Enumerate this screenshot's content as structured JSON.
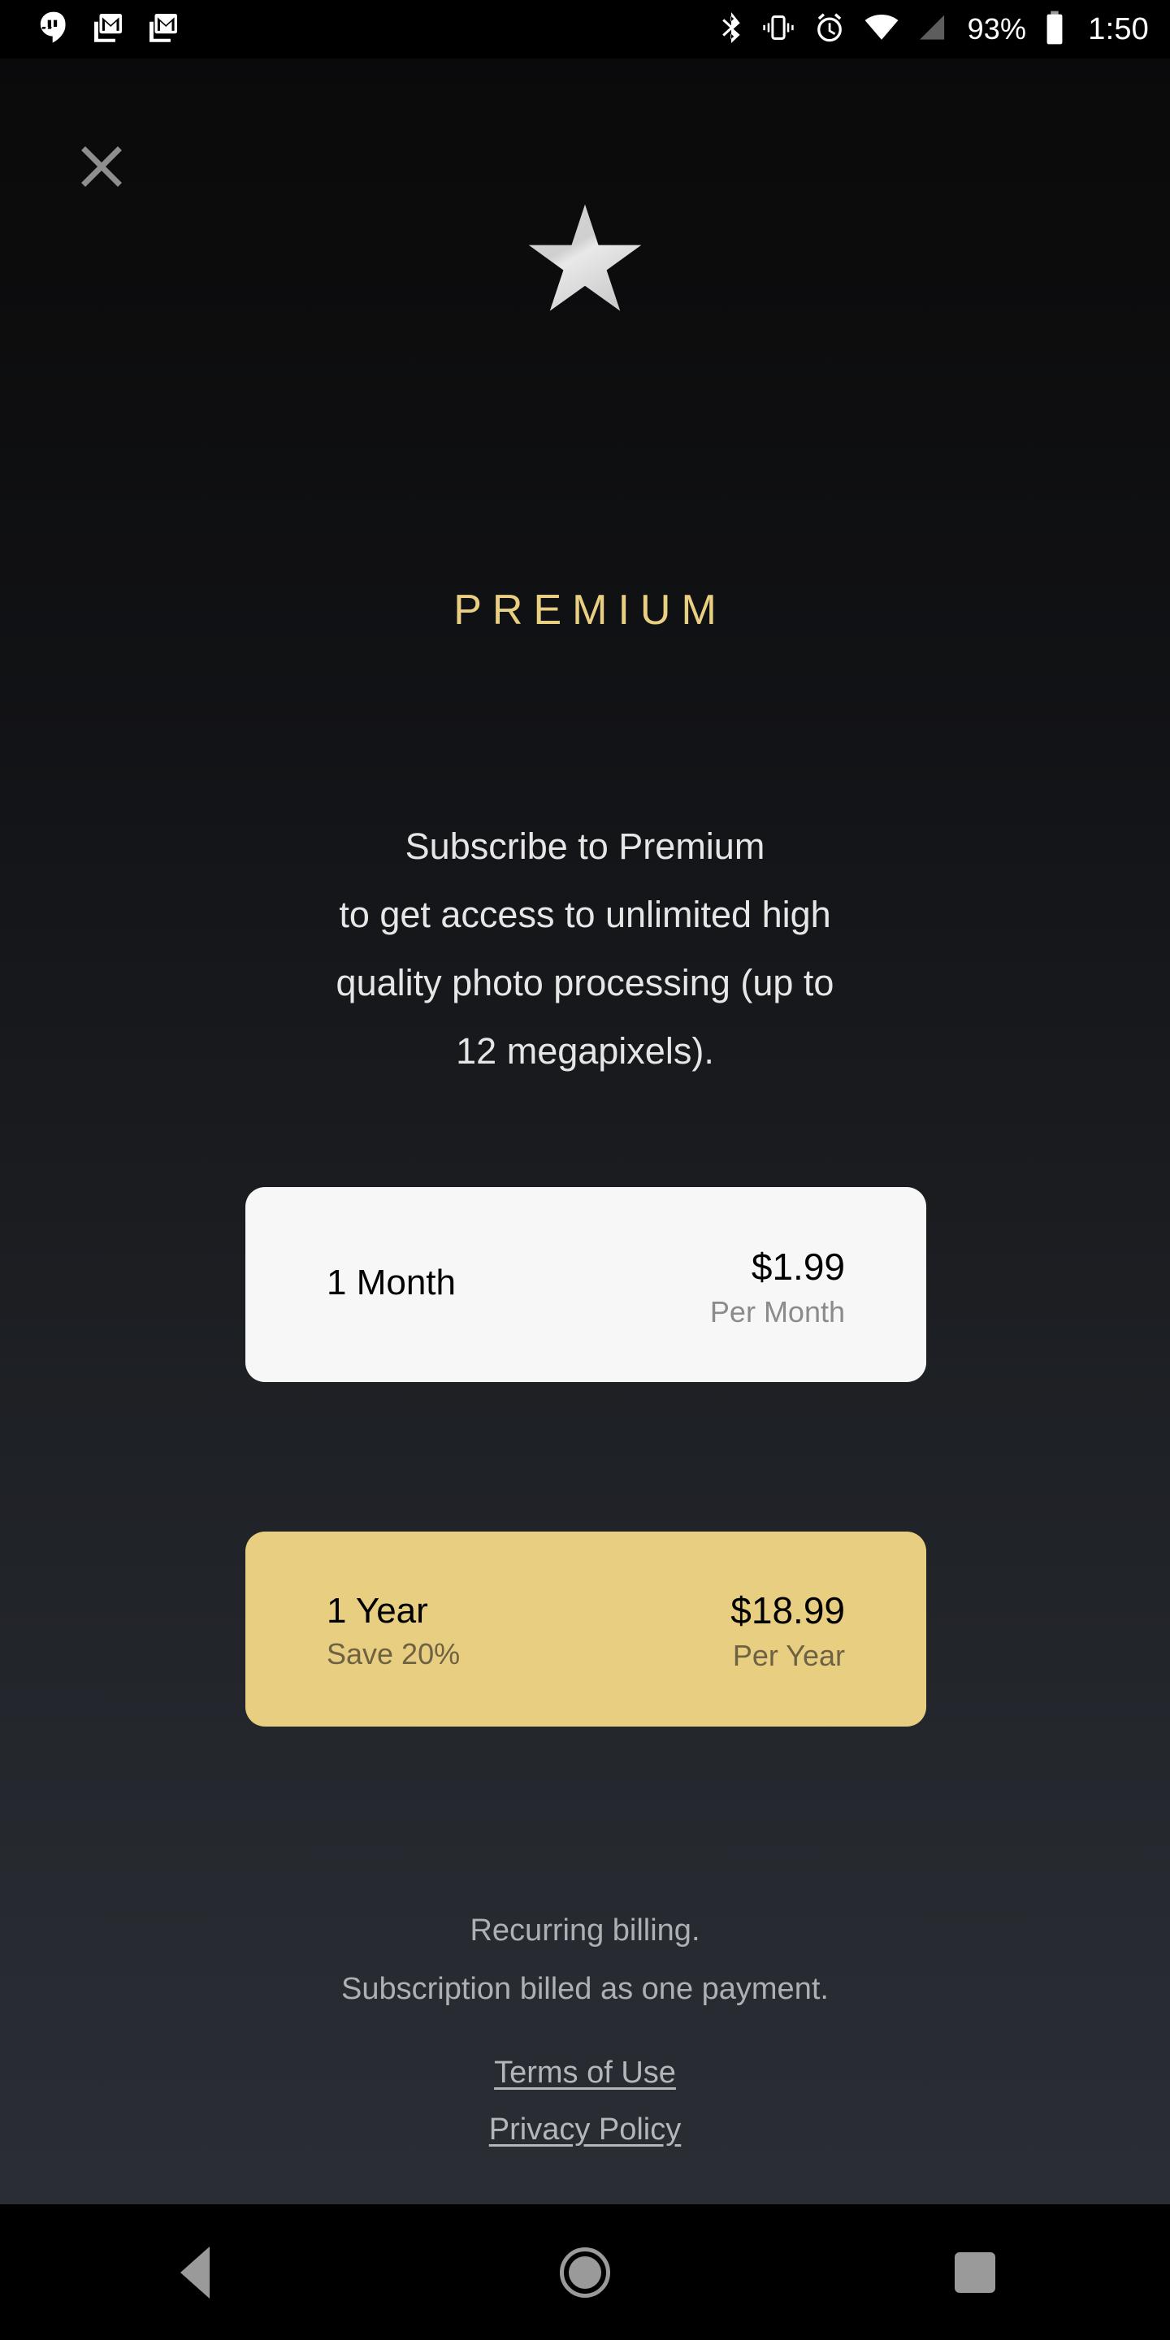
{
  "status_bar": {
    "icons_left": [
      "hangouts-icon",
      "gmail-icon",
      "gmail-icon"
    ],
    "icons_right": [
      "bluetooth-icon",
      "vibrate-icon",
      "alarm-icon",
      "wifi-icon",
      "cell-signal-icon"
    ],
    "battery_percent": "93%",
    "battery_icon": "battery-icon",
    "time": "1:50"
  },
  "header": {
    "close_label": "close-icon",
    "logo": "star-icon",
    "title": "PREMIUM"
  },
  "main": {
    "description": "Subscribe to Premium\nto get access to unlimited high\nquality photo processing (up to\n12 megapixels).",
    "plans": [
      {
        "id": "month",
        "title": "1 Month",
        "subtitle_left": "",
        "price": "$1.99",
        "period": "Per Month",
        "background": "#f7f7f8",
        "selected": false
      },
      {
        "id": "year",
        "title": "1 Year",
        "subtitle_left": "Save 20%",
        "price": "$18.99",
        "period": "Per Year",
        "background": "#e7ce81",
        "selected": true
      }
    ]
  },
  "footer": {
    "billing_note_1": "Recurring billing.",
    "billing_note_2": "Subscription billed as one payment.",
    "links": [
      {
        "label": "Terms of Use"
      },
      {
        "label": "Privacy Policy"
      }
    ]
  },
  "nav_bar": {
    "back": "back-triangle-icon",
    "home": "home-circle-icon",
    "recents": "recents-square-icon"
  },
  "colors": {
    "accent_gold": "#e7ce81",
    "title_gold": "#e9cf81",
    "card_white": "#f7f7f8",
    "bg_top": "#0a0a0b",
    "bg_bottom": "#2a2e34",
    "muted_text": "#aeb1b4"
  }
}
